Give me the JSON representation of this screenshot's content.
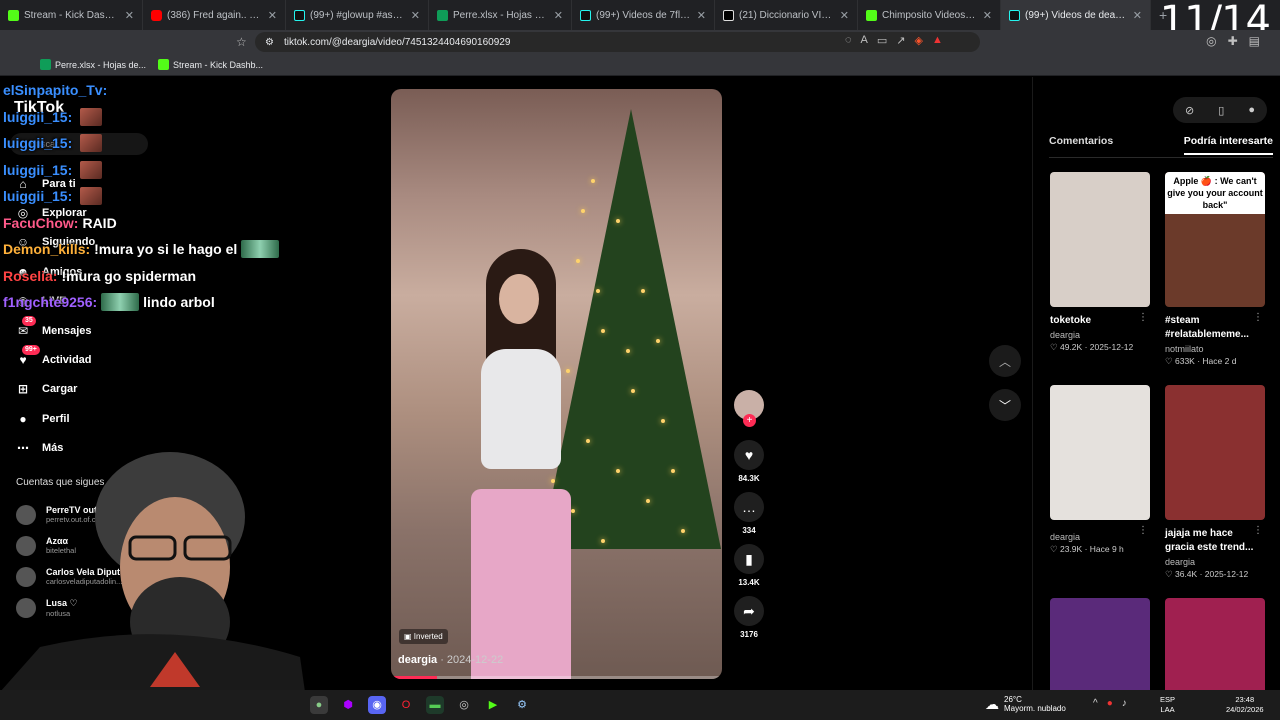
{
  "tabs": [
    {
      "label": "Stream - Kick Dashboard",
      "icon": "kick-icon",
      "active": false
    },
    {
      "label": "(386) Fred again.. x Skepta x Pl",
      "icon": "youtube-icon",
      "active": false
    },
    {
      "label": "(99+) #glowup #ascension | Ti",
      "icon": "tiktok-icon",
      "active": false
    },
    {
      "label": "Perre.xlsx - Hojas de cálculo de",
      "icon": "sheets-icon",
      "active": false
    },
    {
      "label": "(99+) Videos de 7flu (@7culor)",
      "icon": "tiktok-icon",
      "active": false
    },
    {
      "label": "(21) Diccionario VIP en X: \"Dur",
      "icon": "x-icon",
      "active": false
    },
    {
      "label": "Chimposito Videos - Watch Or",
      "icon": "kick-icon",
      "active": false
    },
    {
      "label": "(99+) Videos de deargia (@",
      "icon": "tiktok-icon",
      "active": true
    }
  ],
  "tab_counter": "11/14",
  "url": "tiktok.com/@deargia/video/7451324404690160929",
  "bookmarks": [
    {
      "label": "Perre.xlsx - Hojas de..."
    },
    {
      "label": "Stream - Kick Dashb..."
    }
  ],
  "sidebar": {
    "logo": "TikTok",
    "search_placeholder": "Buscar",
    "nav": [
      {
        "label": "Para ti",
        "icon": "home-icon"
      },
      {
        "label": "Explorar",
        "icon": "compass-icon"
      },
      {
        "label": "Siguiendo",
        "icon": "following-icon"
      },
      {
        "label": "Amigos",
        "icon": "friends-icon"
      },
      {
        "label": "LIVE",
        "icon": "live-icon"
      },
      {
        "label": "Mensajes",
        "icon": "messages-icon",
        "badge": "35"
      },
      {
        "label": "Actividad",
        "icon": "activity-icon",
        "badge": "99+"
      },
      {
        "label": "Cargar",
        "icon": "upload-icon"
      },
      {
        "label": "Perfil",
        "icon": "profile-icon"
      },
      {
        "label": "Más",
        "icon": "more-icon"
      }
    ],
    "following_title": "Cuentas que sigues",
    "following": [
      {
        "name": "PerreTV out o...",
        "handle": "perretv.out.of.co..."
      },
      {
        "name": "Azαα",
        "handle": "bitelethal"
      },
      {
        "name": "Carlos Vela Diput...",
        "handle": "carlosveladiputadolin..."
      },
      {
        "name": "Lusa ♡",
        "handle": "notlusa"
      }
    ]
  },
  "chat": [
    {
      "user": "elSinpapito_Tv:",
      "msg": "",
      "emote": false
    },
    {
      "user": "luiggii_15:",
      "msg": "",
      "emote": true
    },
    {
      "user": "luiggii_15:",
      "msg": "",
      "emote": true
    },
    {
      "user": "luiggii_15:",
      "msg": "",
      "emote": true
    },
    {
      "user": "luiggii_15:",
      "msg": "",
      "emote": true
    },
    {
      "user": "FacuChow:",
      "msg": "RAID",
      "emote": false
    },
    {
      "user": "Demon_kills:",
      "msg": "!mura yo si le hago el",
      "emote": true
    },
    {
      "user": "Roselia:",
      "msg": "!mura go spiderman",
      "emote": false
    },
    {
      "user": "f1ngchte9256:",
      "msg": "lindo arbol",
      "emote": true
    }
  ],
  "chat_colors": [
    "#3a8fff",
    "#3a8fff",
    "#3a8fff",
    "#3a8fff",
    "#3a8fff",
    "#ff5a8a",
    "#ffb13a",
    "#ff4444",
    "#a060ff"
  ],
  "video": {
    "author": "deargia",
    "date": "2024-12-22",
    "tag": "Inverted",
    "progress": 0.14
  },
  "actions": {
    "likes": "84.3K",
    "comments": "334",
    "saves": "13.4K",
    "shares": "3176"
  },
  "right_panel": {
    "tabs": [
      "Comentarios",
      "Podría interesarte"
    ],
    "active_tab": 1,
    "cards": [
      {
        "title": "toketoke",
        "author": "deargia",
        "likes": "49.2K",
        "date": "2025-12-12",
        "thumb": "#d8cfc8"
      },
      {
        "title": "#steam #relatablememe...",
        "author": "notmiilato",
        "likes": "633K",
        "date": "Hace 2 d",
        "thumb": "#6b3a2a",
        "caption": "Apple 🍎 : We can't give you your account back\""
      },
      {
        "title": "",
        "author": "deargia",
        "likes": "23.9K",
        "date": "Hace 9 h",
        "thumb": "#e5e1dd"
      },
      {
        "title": "jajaja me hace gracia este trend...",
        "author": "deargia",
        "likes": "36.4K",
        "date": "2025-12-12",
        "thumb": "#8a3030"
      },
      {
        "title": "",
        "author": "",
        "likes": "",
        "date": "",
        "thumb": "#5a2a7a"
      },
      {
        "title": "",
        "author": "",
        "likes": "",
        "date": "",
        "thumb": "#a02050"
      }
    ]
  },
  "taskbar": {
    "weather_temp": "26°C",
    "weather_desc": "Mayorm. nublado",
    "lang_top": "ESP",
    "lang_bottom": "LAA",
    "time": "23:48",
    "date": "24/02/2026"
  }
}
